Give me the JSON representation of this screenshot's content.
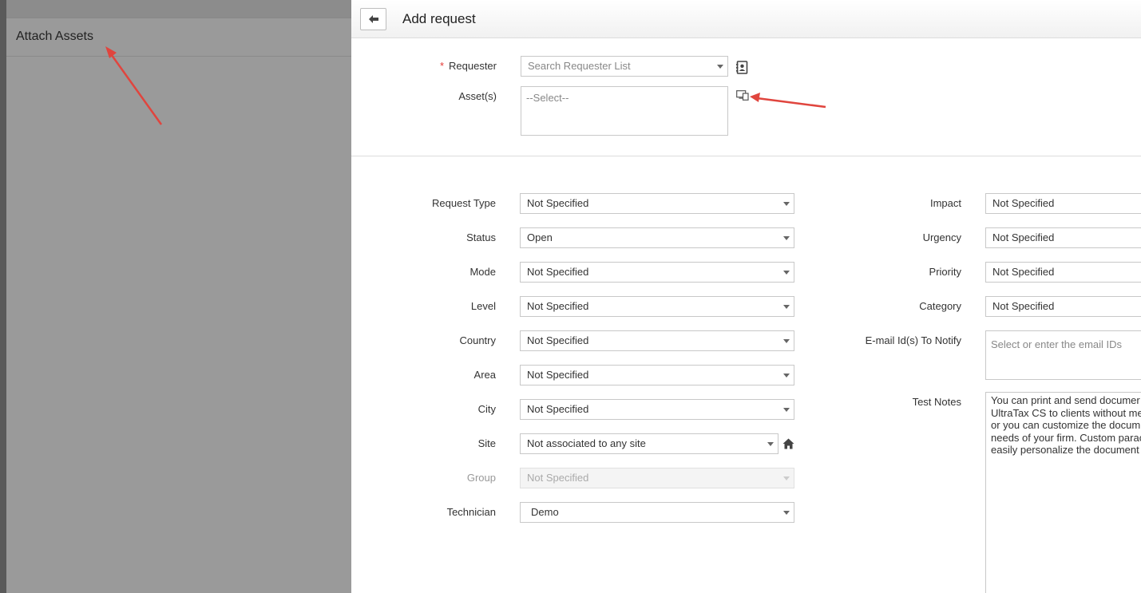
{
  "attach_panel": {
    "title": "Attach Assets"
  },
  "header": {
    "title": "Add request",
    "back_icon": "arrow-left-icon"
  },
  "top_section": {
    "requester": {
      "label": "Requester",
      "required_mark": "*",
      "placeholder": "Search Requester List",
      "icon": "contact-book-icon"
    },
    "assets": {
      "label": "Asset(s)",
      "placeholder": "--Select--",
      "icon": "attach-asset-icon"
    }
  },
  "left_fields": [
    {
      "label": "Request Type",
      "value": "Not Specified"
    },
    {
      "label": "Status",
      "value": "Open"
    },
    {
      "label": "Mode",
      "value": "Not Specified"
    },
    {
      "label": "Level",
      "value": "Not Specified"
    },
    {
      "label": "Country",
      "value": "Not Specified"
    },
    {
      "label": "Area",
      "value": "Not Specified"
    },
    {
      "label": "City",
      "value": "Not Specified"
    },
    {
      "label": "Site",
      "value": "Not associated to any site",
      "icon": "home-icon"
    },
    {
      "label": "Group",
      "value": "Not Specified",
      "disabled": true
    },
    {
      "label": "Technician",
      "value": "Demo"
    }
  ],
  "right_fields": [
    {
      "label": "Impact",
      "value": "Not Specified"
    },
    {
      "label": "Urgency",
      "value": "Not Specified"
    },
    {
      "label": "Priority",
      "value": "Not Specified"
    },
    {
      "label": "Category",
      "value": "Not Specified"
    }
  ],
  "email_notify": {
    "label": "E-mail Id(s) To Notify",
    "placeholder": "Select or enter the email IDs"
  },
  "test_notes": {
    "label": "Test Notes",
    "lines": [
      "You can print and send documer",
      "UltraTax CS to clients without me",
      "or you can customize the docum",
      "needs of your firm. Custom parac",
      "easily personalize the document"
    ]
  },
  "colors": {
    "annotation_arrow": "#e0453e",
    "required_star": "#e53935",
    "dim_overlay": "#9a9a9a"
  }
}
